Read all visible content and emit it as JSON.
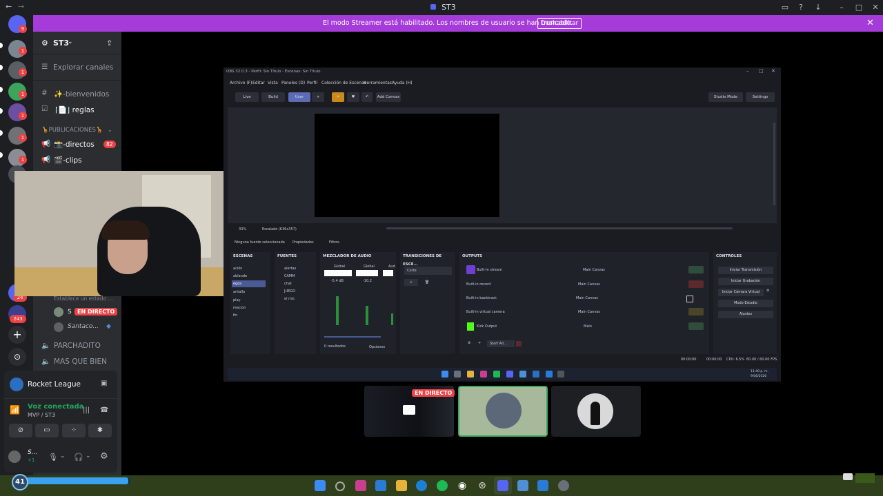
{
  "window": {
    "title": "ST3",
    "back_icon": "arrow-left-icon",
    "forward_icon": "arrow-right-icon"
  },
  "banner": {
    "message": "El modo Streamer está habilitado. Los nombres de usuario se han truncado.",
    "button": "Deshabilitar",
    "color": "#a53bd8"
  },
  "rail": {
    "badges": [
      "9",
      "1",
      "1",
      "1",
      "1",
      "1",
      "1",
      "1",
      "24",
      "243"
    ]
  },
  "server": {
    "name": "ST3",
    "explore": "Explorar canales",
    "channels": [
      {
        "name": "✨-bienvenidos"
      },
      {
        "name": "⌈📄⌋ reglas"
      },
      {
        "name": "🦒PUBLICACIONES🦒"
      },
      {
        "name": "📸-directos",
        "badge": "82"
      },
      {
        "name": "🎬-clips"
      }
    ],
    "status_placeholder": "Establece un estado ...",
    "live_user": "S",
    "live_label": "EN DIRECTO",
    "live_user2": "Santaco...",
    "voice_channels": [
      "PARCHADITO",
      "MAS QUE BIEN"
    ]
  },
  "activity": {
    "game": "Rocket League",
    "voice_status": "Voz conectada",
    "voice_location": "MVP / ST3",
    "user": "S...",
    "user_sub": "+1"
  },
  "obs": {
    "title": "OBS 32.0.3 - Perfil: Sin Título - Escenas: Sin Título",
    "menu": [
      "Archivo (F)",
      "Editar",
      "Vista",
      "Paneles (D)",
      "Perfil",
      "Colección de Escenas",
      "Herramientas",
      "Ayuda (H)"
    ],
    "toolbar": [
      "Live",
      "Build",
      "User",
      "Add Canvas"
    ],
    "studio_mode": "Studio Mode",
    "settings": "Settings",
    "zoom": "33%",
    "scale_mode": "Escalado (636x357)",
    "no_source": "Ninguna fuente seleccionada",
    "properties": "Propiedades",
    "filters": "Filtros",
    "docks": {
      "scenes": "ESCENAS",
      "sources": "FUENTES",
      "mixer": "MEZCLADOR DE AUDIO",
      "transitions": "TRANSICIONES DE ESCE...",
      "outputs": "OUTPUTS",
      "controls": "CONTROLES"
    },
    "scenes": [
      "ación",
      "ablando",
      "egos",
      "antalla",
      "play",
      "reacion",
      "fin"
    ],
    "sources": [
      "alertas",
      "CAMM",
      "chat",
      "JUEGO",
      "el mic"
    ],
    "mixer_channels": [
      "Global",
      "Global",
      "Aud"
    ],
    "mixer_levels": [
      "-5.4 dB",
      "-10.2",
      ""
    ],
    "mixer_footer": "0 resultados",
    "mixer_options": "Opciones",
    "transition": "Corte",
    "outputs": [
      {
        "name": "Built-in stream",
        "canvas": "Main Canvas"
      },
      {
        "name": "Built-in record",
        "canvas": "Main Canvas"
      },
      {
        "name": "Built-in backtrack",
        "canvas": "Main Canvas"
      },
      {
        "name": "Built-in virtual camera",
        "canvas": "Main Canvas"
      },
      {
        "name": "Kick Output",
        "canvas": "Main"
      }
    ],
    "start_all": "Start All...",
    "controls": [
      "Iniciar Transmisión",
      "Iniciar Grabación",
      "Iniciar Cámara Virtual",
      "Modo Estudio",
      "Ajustes"
    ],
    "status": {
      "time1": "00:00:00",
      "time2": "00:00:00",
      "cpu": "CPU: 6.5%",
      "fps": "60.00 / 60.00 FPS"
    },
    "clock": {
      "time": "11:40 p. m.",
      "date": "9/06/2026"
    }
  },
  "tiles": {
    "live_label": "EN DIRECTO"
  },
  "taskbar": {
    "level": "41",
    "colors": {
      "accent": "#5865f2",
      "live": "#ed4245"
    }
  }
}
